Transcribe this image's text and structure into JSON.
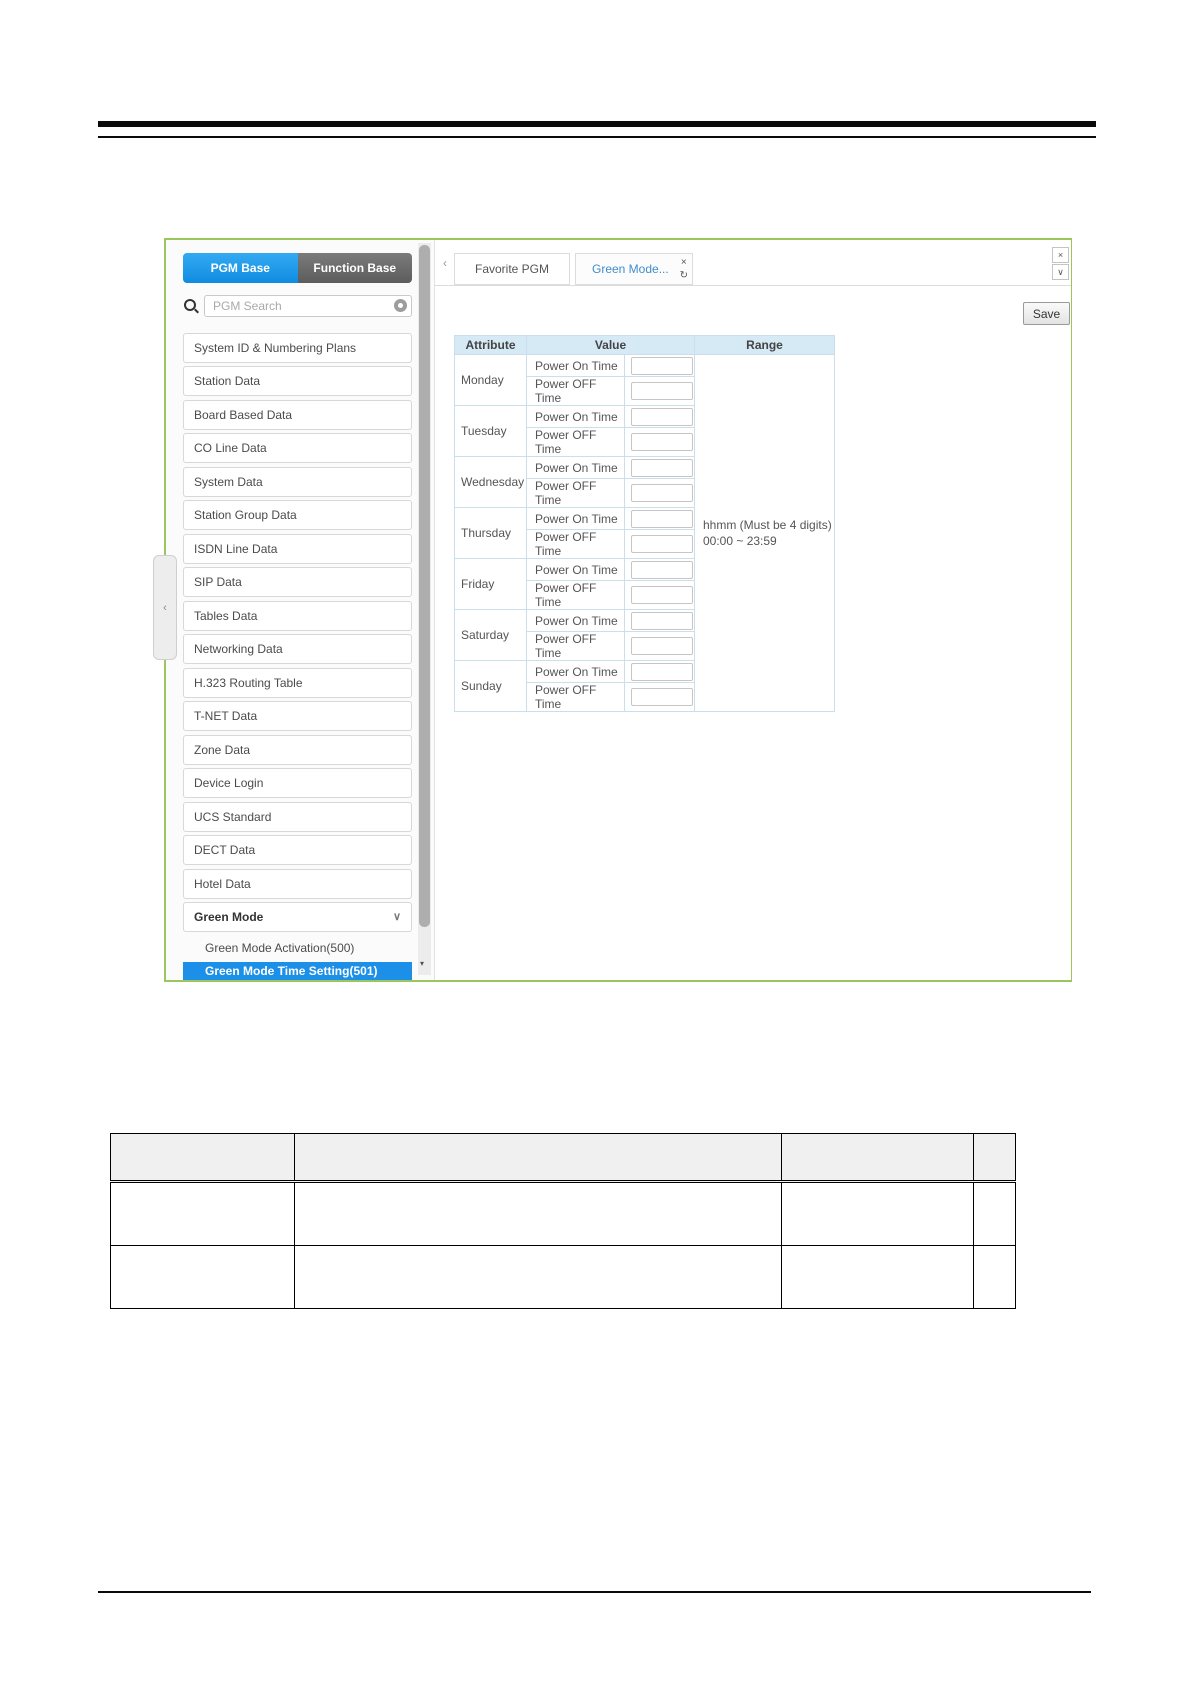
{
  "colors": {
    "container_border_green": "#9bc65c",
    "pgm_base_blue": "#1d9ce8",
    "function_base_gray": "#6a6a6a",
    "selected_item_blue": "#1c8fe8",
    "tab_text_blue": "#3f8ccc",
    "table_header_bg": "#d6eaf6"
  },
  "sidebar": {
    "pgm_base_label": "PGM Base",
    "function_base_label": "Function Base",
    "search": {
      "placeholder": "PGM Search"
    },
    "items": [
      {
        "label": "System ID & Numbering Plans"
      },
      {
        "label": "Station Data"
      },
      {
        "label": "Board Based Data"
      },
      {
        "label": "CO Line Data"
      },
      {
        "label": "System Data"
      },
      {
        "label": "Station Group Data"
      },
      {
        "label": "ISDN Line Data"
      },
      {
        "label": "SIP Data"
      },
      {
        "label": "Tables Data"
      },
      {
        "label": "Networking Data"
      },
      {
        "label": "H.323 Routing Table"
      },
      {
        "label": "T-NET Data"
      },
      {
        "label": "Zone Data"
      },
      {
        "label": "Device Login"
      },
      {
        "label": "UCS Standard"
      },
      {
        "label": "DECT Data"
      },
      {
        "label": "Hotel Data"
      }
    ],
    "green_mode": {
      "label": "Green Mode",
      "chevron": "∨",
      "children": [
        {
          "label": "Green Mode Activation(500)"
        },
        {
          "label": "Green Mode Time Setting(501)"
        }
      ]
    },
    "collapse_chevron": "‹",
    "scroll_down_arrow": "▾"
  },
  "tabs": {
    "back_chevron": "‹",
    "favorite_label": "Favorite PGM",
    "green_label": "Green Mode...",
    "tab_close": "×",
    "tab_refresh": "↻",
    "window_close": "×",
    "window_collapse": "∨"
  },
  "main": {
    "save_label": "Save",
    "table": {
      "headers": [
        "Attribute",
        "Value",
        "Range"
      ],
      "days": [
        "Monday",
        "Tuesday",
        "Wednesday",
        "Thursday",
        "Friday",
        "Saturday",
        "Sunday"
      ],
      "value_labels": [
        "Power On Time",
        "Power OFF Time"
      ],
      "input_value": "",
      "range_line1": "hhmm (Must be 4 digits)",
      "range_line2": "00:00 ~ 23:59"
    }
  },
  "bottom_table": {
    "header": [
      "",
      "",
      "",
      ""
    ],
    "rows": [
      [
        "",
        "",
        "",
        ""
      ],
      [
        "",
        "",
        "",
        ""
      ]
    ]
  }
}
